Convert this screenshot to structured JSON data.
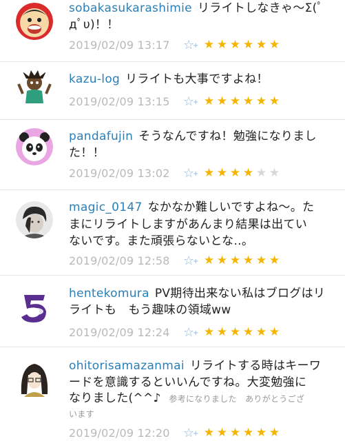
{
  "comments": [
    {
      "user": "sobakasukarashimie",
      "line1": "リライトしなきゃ～Σ(ﾟ",
      "line2": "дﾟυ)！！",
      "time": "2019/02/09 13:17",
      "rating": 6
    },
    {
      "user": "kazu-log",
      "line1": "リライトも大事ですよね！",
      "time": "2019/02/09 13:15",
      "rating": 6
    },
    {
      "user": "pandafujin",
      "line1": "そうなんですね！勉強になりまし",
      "line2": "た！！",
      "time": "2019/02/09 13:02",
      "rating": 4
    },
    {
      "user": "magic_0147",
      "line1": "なかなか難しいですよね～。た",
      "line2": "まにリライトしますがあんまり結果は出てい",
      "line3": "ないです。また頑張らないとな..。",
      "time": "2019/02/09 12:58",
      "rating": 6
    },
    {
      "user": "hentekomura",
      "line1": "PV期待出来ない私はブログはリ",
      "line2": "ライトも　もう趣味の領域ww",
      "time": "2019/02/09 12:24",
      "rating": 6
    },
    {
      "user": "ohitorisamazanmai",
      "line1": "リライトする時はキーワ",
      "line2": "ードを意識するといいんですね。大変勉強に",
      "line3": "なりました(^^♪",
      "note1": "参考になりました　ありがとうござ",
      "note2": "います",
      "time": "2019/02/09 12:20",
      "rating": 6
    }
  ],
  "icons": {
    "add_star": "star-outline-plus-icon",
    "rating_star": "star-icon"
  },
  "colors": {
    "username": "#2a7fb8",
    "star_on": "#f5b400",
    "star_off": "#d8d8d8",
    "timestamp": "#b9b9b9"
  }
}
